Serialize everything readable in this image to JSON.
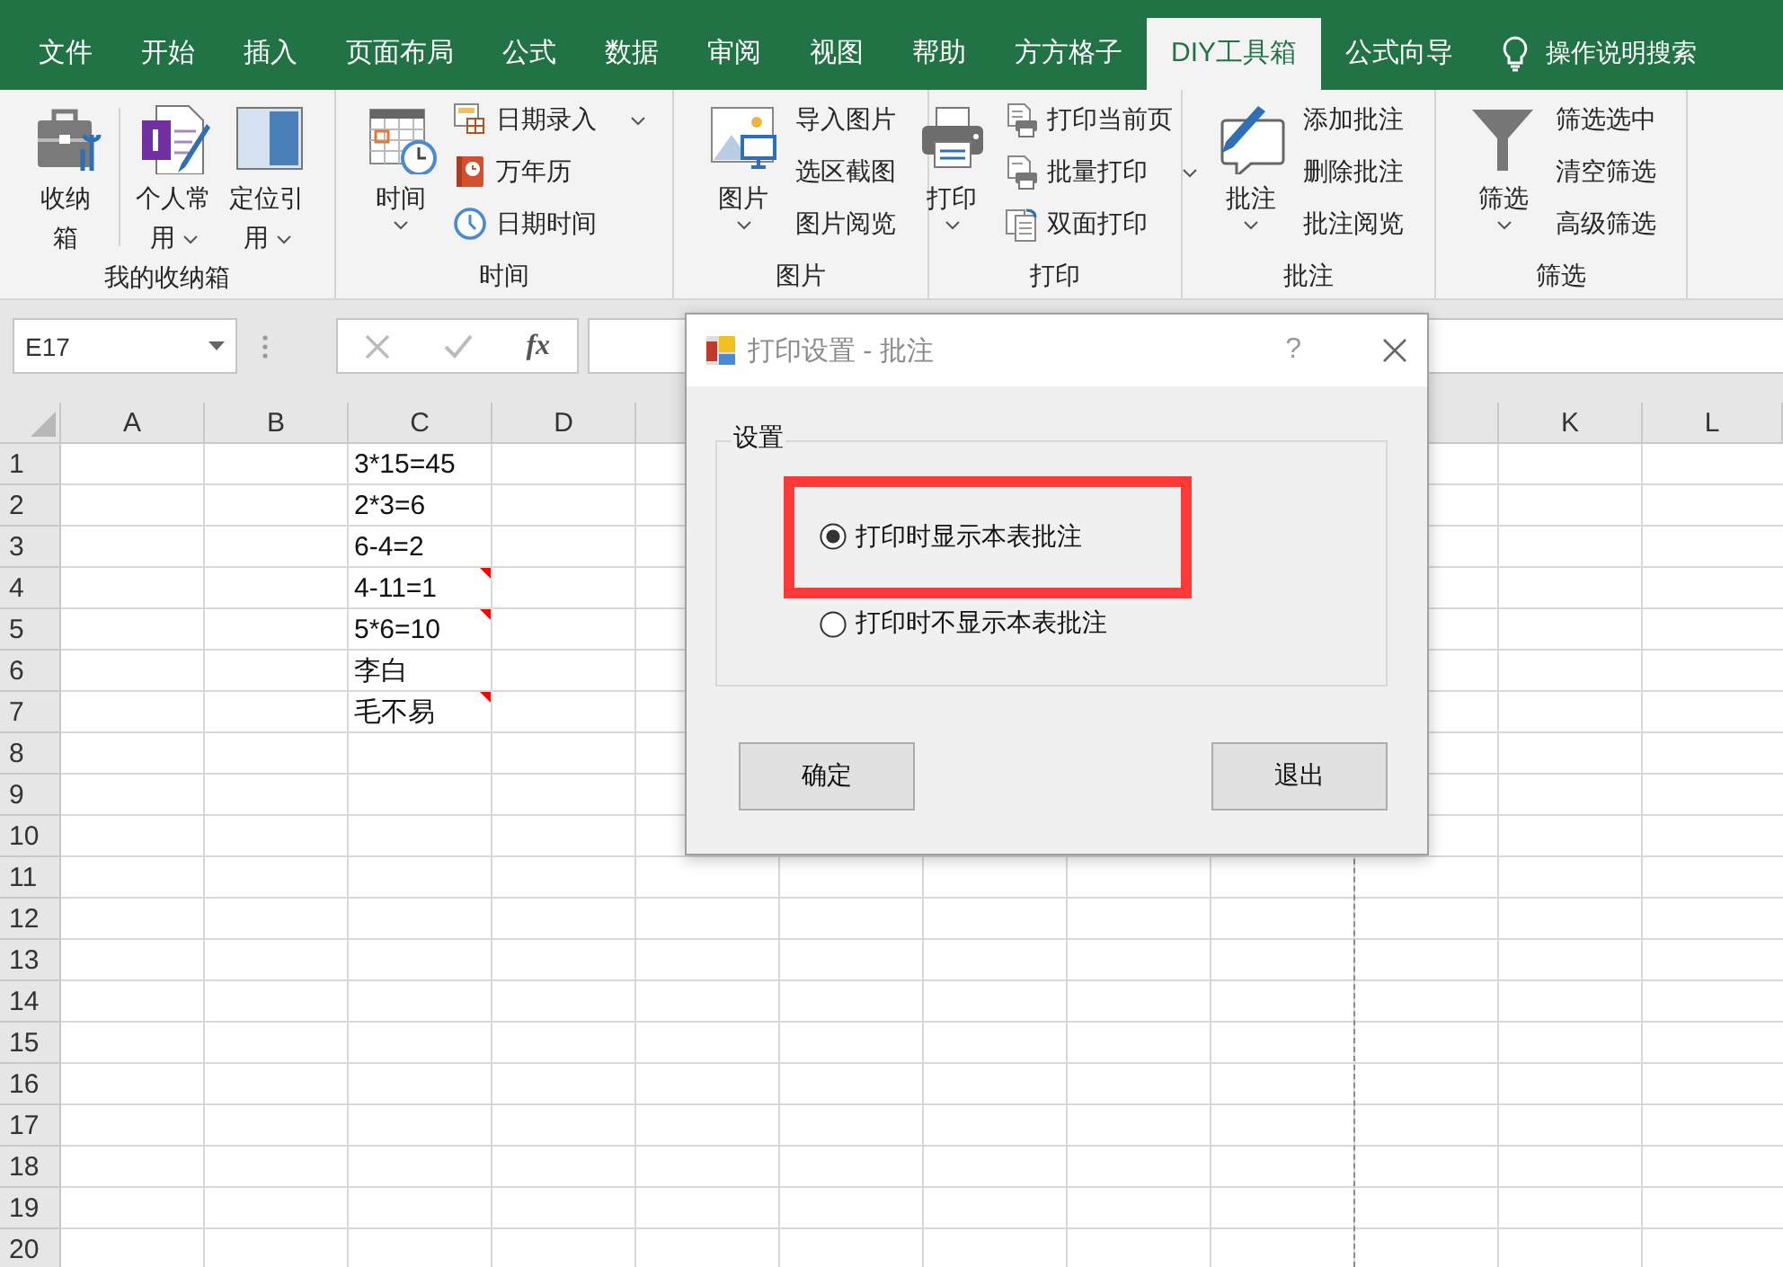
{
  "tabs": [
    {
      "label": "文件",
      "selected": false
    },
    {
      "label": "开始",
      "selected": false
    },
    {
      "label": "插入",
      "selected": false
    },
    {
      "label": "页面布局",
      "selected": false
    },
    {
      "label": "公式",
      "selected": false
    },
    {
      "label": "数据",
      "selected": false
    },
    {
      "label": "审阅",
      "selected": false
    },
    {
      "label": "视图",
      "selected": false
    },
    {
      "label": "帮助",
      "selected": false
    },
    {
      "label": "方方格子",
      "selected": false
    },
    {
      "label": "DIY工具箱",
      "selected": true
    },
    {
      "label": "公式向导",
      "selected": false
    }
  ],
  "tell_me": {
    "label": "操作说明搜索"
  },
  "ribbon_groups": [
    {
      "title": "我的收纳箱",
      "items": [
        {
          "kind": "large",
          "label": "收纳箱",
          "dropdown": false
        },
        {
          "kind": "large",
          "label": "个人常用",
          "dropdown": true
        },
        {
          "kind": "large",
          "label": "定位引用",
          "dropdown": true
        }
      ]
    },
    {
      "title": "时间",
      "items": [
        {
          "kind": "large",
          "label": "时间",
          "dropdown": true
        },
        {
          "kind": "small",
          "label": "日期录入",
          "dropdown": true
        },
        {
          "kind": "small",
          "label": "万年历",
          "dropdown": false
        },
        {
          "kind": "small",
          "label": "日期时间",
          "dropdown": false
        }
      ]
    },
    {
      "title": "图片",
      "items": [
        {
          "kind": "large",
          "label": "图片",
          "dropdown": true
        },
        {
          "kind": "text",
          "label": "导入图片",
          "dropdown": false
        },
        {
          "kind": "text",
          "label": "选区截图",
          "dropdown": false
        },
        {
          "kind": "text",
          "label": "图片阅览",
          "dropdown": false
        }
      ]
    },
    {
      "title": "打印",
      "items": [
        {
          "kind": "large",
          "label": "打印",
          "dropdown": true
        },
        {
          "kind": "small",
          "label": "打印当前页",
          "dropdown": false
        },
        {
          "kind": "small",
          "label": "批量打印",
          "dropdown": true
        },
        {
          "kind": "small",
          "label": "双面打印",
          "dropdown": false
        }
      ]
    },
    {
      "title": "批注",
      "items": [
        {
          "kind": "large",
          "label": "批注",
          "dropdown": true
        },
        {
          "kind": "text",
          "label": "添加批注",
          "dropdown": false
        },
        {
          "kind": "text",
          "label": "删除批注",
          "dropdown": false
        },
        {
          "kind": "text",
          "label": "批注阅览",
          "dropdown": false
        }
      ]
    },
    {
      "title": "筛选",
      "items": [
        {
          "kind": "large",
          "label": "筛选",
          "dropdown": true
        },
        {
          "kind": "text",
          "label": "筛选选中",
          "dropdown": false
        },
        {
          "kind": "text",
          "label": "清空筛选",
          "dropdown": false
        },
        {
          "kind": "text",
          "label": "高级筛选",
          "dropdown": false
        }
      ]
    }
  ],
  "formula_bar": {
    "name_box": "E17",
    "function_label": "fx"
  },
  "sheet": {
    "columns": [
      "A",
      "B",
      "C",
      "D",
      "K",
      "L"
    ],
    "rows": [
      {
        "number": "1",
        "c": "3*15=45",
        "comment": false
      },
      {
        "number": "2",
        "c": "2*3=6",
        "comment": false
      },
      {
        "number": "3",
        "c": "6-4=2",
        "comment": false
      },
      {
        "number": "4",
        "c": "4-11=1",
        "comment": true
      },
      {
        "number": "5",
        "c": "5*6=10",
        "comment": true
      },
      {
        "number": "6",
        "c": "李白",
        "comment": false
      },
      {
        "number": "7",
        "c": "毛不易",
        "comment": true
      },
      {
        "number": "8"
      },
      {
        "number": "9"
      },
      {
        "number": "10"
      },
      {
        "number": "11"
      },
      {
        "number": "12"
      },
      {
        "number": "13"
      },
      {
        "number": "14"
      },
      {
        "number": "15"
      },
      {
        "number": "16"
      },
      {
        "number": "17"
      },
      {
        "number": "18"
      },
      {
        "number": "19"
      },
      {
        "number": "20"
      }
    ]
  },
  "dialog": {
    "title": "打印设置 - 批注",
    "help": "?",
    "group_title": "设置",
    "options": [
      {
        "label": "打印时显示本表批注",
        "selected": true,
        "highlighted": true
      },
      {
        "label": "打印时不显示本表批注",
        "selected": false,
        "highlighted": false
      }
    ],
    "buttons": [
      "确定",
      "退出"
    ]
  }
}
